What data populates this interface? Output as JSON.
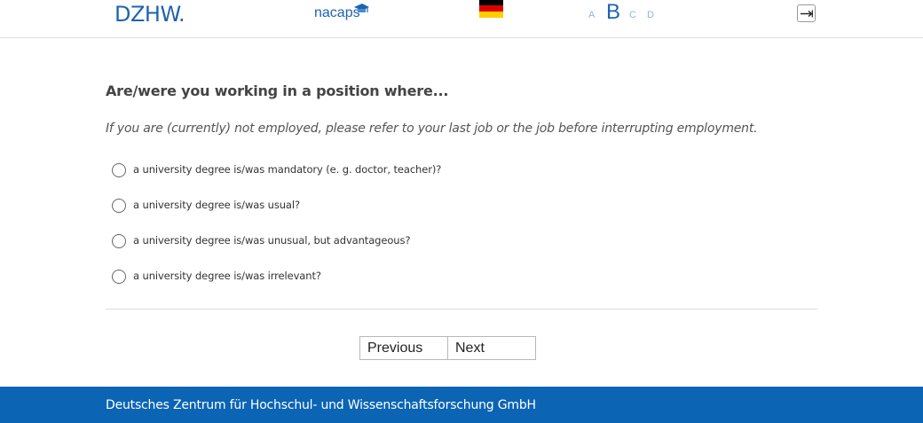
{
  "header": {
    "logo_dzhw": "DZHW.",
    "logo_nacaps": "nacaps",
    "language_flag_icon": "german-flag-icon",
    "font_size_options": [
      "A",
      "B",
      "C",
      "D"
    ],
    "selected_font_size": "B",
    "logout_icon": "logout-arrow-icon"
  },
  "question": {
    "title": "Are/were you working in a position where...",
    "instruction": "If you are (currently) not employed, please refer to your last job or the job before interrupting employment.",
    "options": [
      "a university degree is/was mandatory (e. g. doctor, teacher)?",
      "a university degree is/was usual?",
      "a university degree is/was unusual, but advantageous?",
      "a university degree is/was irrelevant?"
    ]
  },
  "navigation": {
    "previous_label": "Previous",
    "next_label": "Next"
  },
  "footer": {
    "text": "Deutsches Zentrum für Hochschul- und Wissenschaftsforschung GmbH"
  },
  "colors": {
    "brand_blue": "#1f63b0",
    "footer_blue": "#0b64b4",
    "light_blue": "#8ab8e0"
  }
}
